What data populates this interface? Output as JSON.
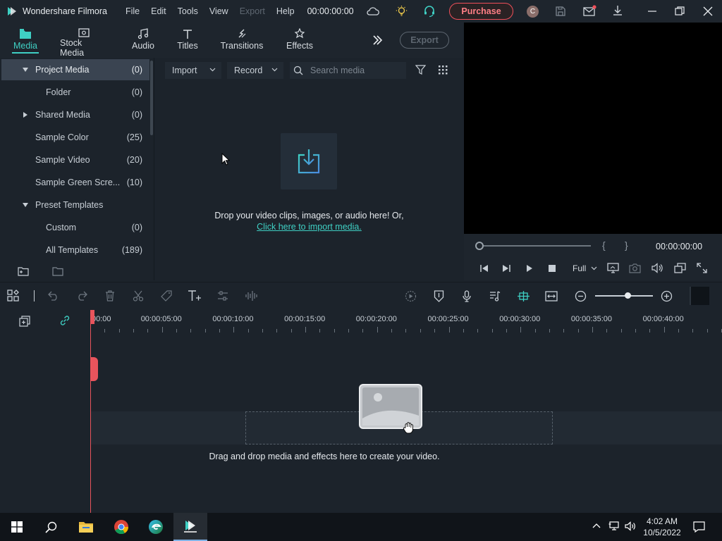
{
  "app": {
    "title": "Wondershare Filmora",
    "menu": [
      "File",
      "Edit",
      "Tools",
      "View",
      "Export",
      "Help"
    ],
    "disabled_menu": "Export",
    "timecode": "00:00:00:00",
    "purchase_label": "Purchase",
    "avatar_letter": "C"
  },
  "tabs": [
    {
      "label": "Media",
      "icon": "media-folder-icon",
      "active": true
    },
    {
      "label": "Stock Media",
      "icon": "stock-media-icon"
    },
    {
      "label": "Audio",
      "icon": "music-note-icon"
    },
    {
      "label": "Titles",
      "icon": "text-t-icon"
    },
    {
      "label": "Transitions",
      "icon": "transitions-icon"
    },
    {
      "label": "Effects",
      "icon": "effects-icon"
    }
  ],
  "export_label": "Export",
  "sidebar": {
    "items": [
      {
        "label": "Project Media",
        "count": "(0)",
        "expanded": true,
        "selected": true
      },
      {
        "label": "Folder",
        "count": "(0)"
      },
      {
        "label": "Shared Media",
        "count": "(0)",
        "collapsed": true
      },
      {
        "label": "Sample Color",
        "count": "(25)"
      },
      {
        "label": "Sample Video",
        "count": "(20)"
      },
      {
        "label": "Sample Green Scre...",
        "count": "(10)"
      },
      {
        "label": "Preset Templates",
        "count": "",
        "expanded": true
      },
      {
        "label": "Custom",
        "count": "(0)"
      },
      {
        "label": "All Templates",
        "count": "(189)"
      }
    ]
  },
  "media": {
    "import_label": "Import",
    "record_label": "Record",
    "search_placeholder": "Search media",
    "drop_text": "Drop your video clips, images, or audio here! Or,",
    "import_link": "Click here to import media."
  },
  "preview": {
    "timecode": "00:00:00:00",
    "quality": "Full",
    "brace_left": "{",
    "brace_right": "}"
  },
  "timeline": {
    "ruler": [
      "00:00",
      "00:00:05:00",
      "00:00:10:00",
      "00:00:15:00",
      "00:00:20:00",
      "00:00:25:00",
      "00:00:30:00",
      "00:00:35:00",
      "00:00:40:00"
    ],
    "drop_text": "Drag and drop media and effects here to create your video."
  },
  "taskbar": {
    "time": "4:02 AM",
    "date": "10/5/2022"
  },
  "colors": {
    "accent": "#3fd0c4",
    "purchase": "#f0505a",
    "playhead": "#e8545c"
  }
}
